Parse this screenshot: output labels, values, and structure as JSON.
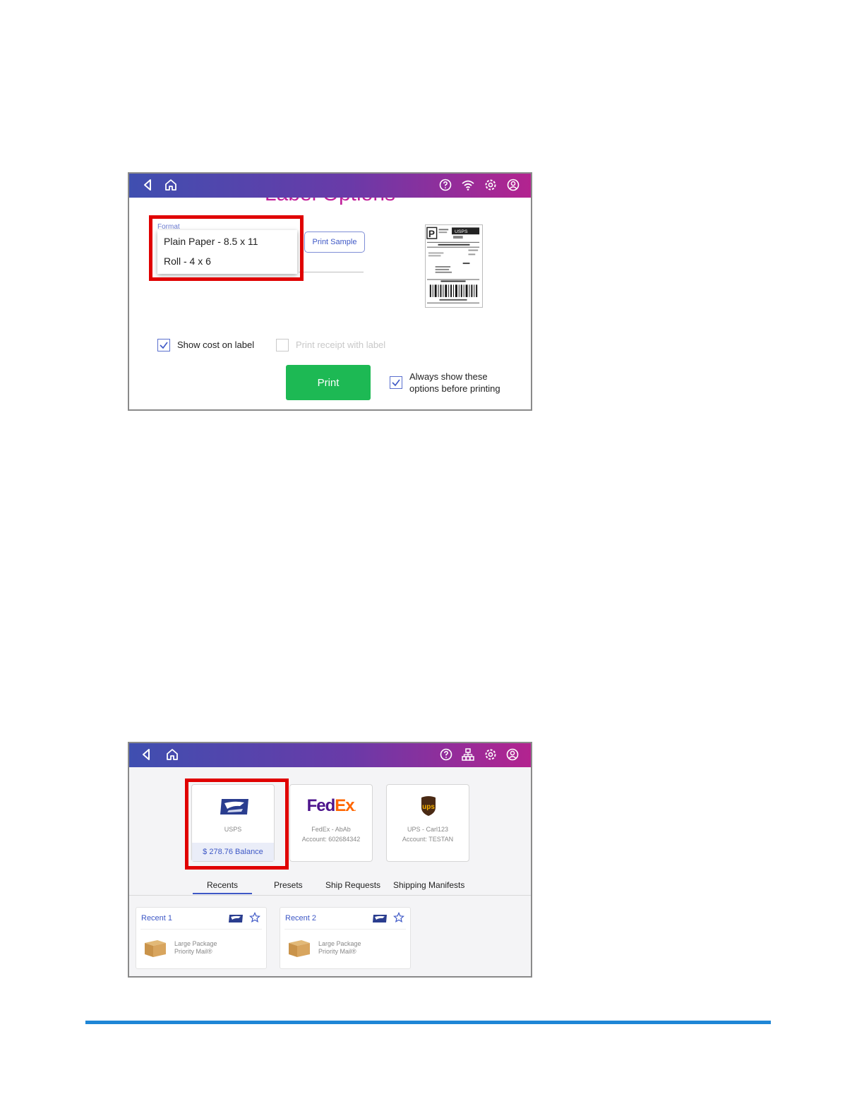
{
  "label_options_screen": {
    "title": "Label Options",
    "format": {
      "label": "Format",
      "options": [
        "Plain Paper - 8.5 x 11",
        "Roll - 4 x 6"
      ]
    },
    "print_sample_label": "Print Sample",
    "label_preview_text": "USPS",
    "show_cost_checkbox": {
      "label": "Show cost on label",
      "checked": true
    },
    "print_receipt_checkbox": {
      "label": "Print receipt with label",
      "checked": false
    },
    "print_button_label": "Print",
    "always_show_checkbox": {
      "line1": "Always show these",
      "line2": "options before printing",
      "checked": true
    },
    "top_icons": [
      "back-icon",
      "home-icon",
      "help-icon",
      "wifi-icon",
      "settings-icon",
      "account-icon"
    ]
  },
  "carrier_screen": {
    "top_icons": [
      "back-icon",
      "home-icon",
      "help-icon",
      "network-icon",
      "settings-icon",
      "account-icon"
    ],
    "carriers": [
      {
        "name": "USPS",
        "account": "",
        "balance": "$ 278.76  Balance",
        "logo": "usps-eagle-icon"
      },
      {
        "name": "FedEx - AbAb",
        "account": "Account: 602684342",
        "logo_text_fed": "Fed",
        "logo_text_ex": "Ex",
        "logo": "fedex-logo"
      },
      {
        "name": "UPS - Carl123",
        "account": "Account: TESTAN",
        "logo_text": "ups",
        "logo": "ups-logo"
      }
    ],
    "tabs": [
      "Recents",
      "Presets",
      "Ship Requests",
      "Shipping Manifests"
    ],
    "active_tab": "Recents",
    "recents": [
      {
        "title": "Recent 1",
        "line1": "Large Package",
        "line2": "Priority Mail®"
      },
      {
        "title": "Recent 2",
        "line1": "Large Package",
        "line2": "Priority Mail®"
      }
    ]
  },
  "colors": {
    "header_start": "#3f4fb0",
    "header_end": "#b3238f",
    "highlight": "#e00000",
    "print_button": "#1db954",
    "accent": "#3e58c6",
    "footer_rule": "#1f86d6"
  }
}
